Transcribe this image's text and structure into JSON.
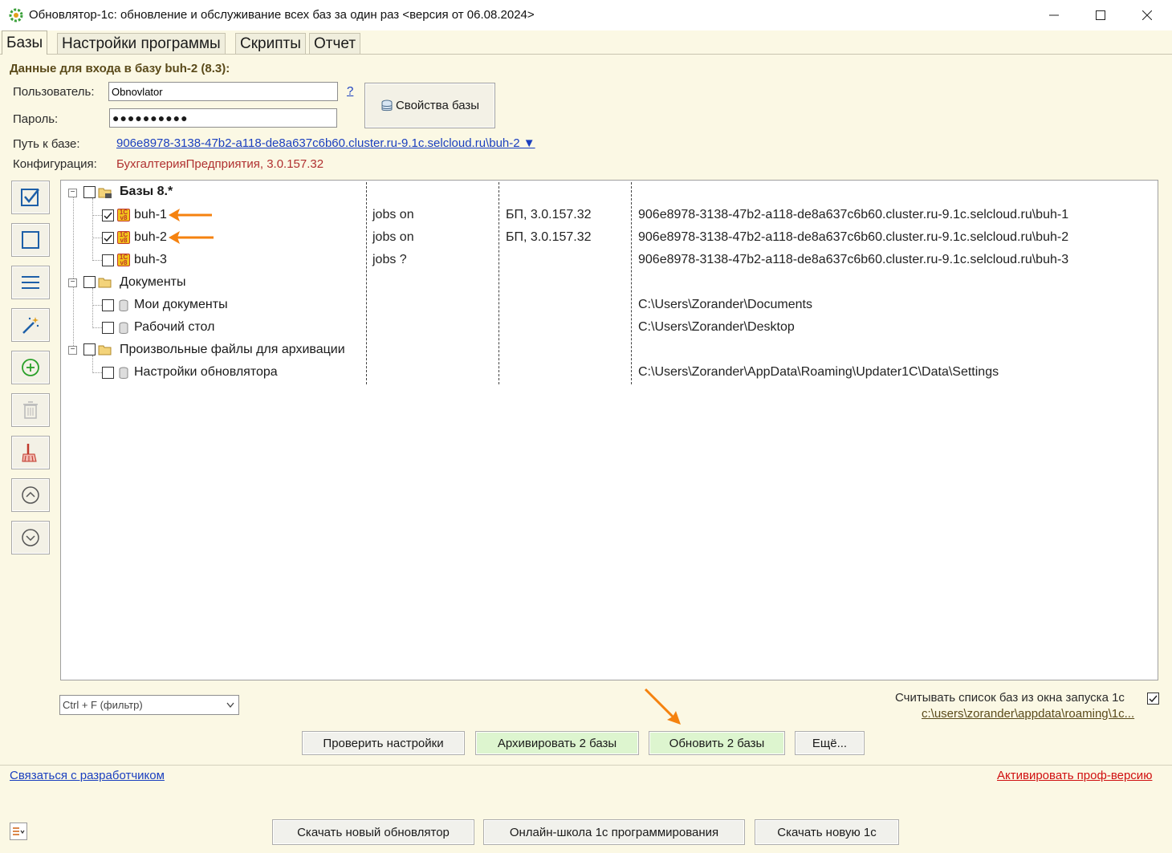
{
  "window": {
    "title": "Обновлятор-1с: обновление и обслуживание всех баз за один раз <версия от 06.08.2024>"
  },
  "tabs": [
    {
      "label": "Базы",
      "active": true
    },
    {
      "label": "Настройки программы",
      "active": false
    },
    {
      "label": "Скрипты",
      "active": false
    },
    {
      "label": "Отчет",
      "active": false
    }
  ],
  "login": {
    "heading": "Данные для входа в базу buh-2 (8.3):",
    "user_label": "Пользователь:",
    "user_value": "Obnovlator",
    "help_link": "?",
    "password_label": "Пароль:",
    "password_value": "●●●●●●●●●●",
    "db_props_button": "Свойства базы",
    "path_label": "Путь к базе:",
    "path_value": "906e8978-3138-47b2-a118-de8a637c6b60.cluster.ru-9.1c.selcloud.ru\\buh-2 ▼",
    "config_label": "Конфигурация:",
    "config_value": "БухгалтерияПредприятия, 3.0.157.32"
  },
  "tree": {
    "groups": [
      {
        "label": "Базы 8.*",
        "bold": true,
        "items": [
          {
            "name": "buh-1",
            "checked": true,
            "jobs": "jobs on",
            "config": "БП, 3.0.157.32",
            "path": "906e8978-3138-47b2-a118-de8a637c6b60.cluster.ru-9.1c.selcloud.ru\\buh-1"
          },
          {
            "name": "buh-2",
            "checked": true,
            "jobs": "jobs on",
            "config": "БП, 3.0.157.32",
            "path": "906e8978-3138-47b2-a118-de8a637c6b60.cluster.ru-9.1c.selcloud.ru\\buh-2"
          },
          {
            "name": "buh-3",
            "checked": false,
            "jobs": "jobs ?",
            "config": "",
            "path": "906e8978-3138-47b2-a118-de8a637c6b60.cluster.ru-9.1c.selcloud.ru\\buh-3"
          }
        ]
      },
      {
        "label": "Документы",
        "bold": false,
        "items": [
          {
            "name": "Мои документы",
            "checked": false,
            "jobs": "",
            "config": "",
            "path": "C:\\Users\\Zorander\\Documents"
          },
          {
            "name": "Рабочий стол",
            "checked": false,
            "jobs": "",
            "config": "",
            "path": "C:\\Users\\Zorander\\Desktop"
          }
        ]
      },
      {
        "label": "Произвольные файлы для архивации",
        "bold": false,
        "items": [
          {
            "name": "Настройки обновлятора",
            "checked": false,
            "jobs": "",
            "config": "",
            "path": "C:\\Users\\Zorander\\AppData\\Roaming\\Updater1C\\Data\\Settings"
          }
        ]
      }
    ]
  },
  "filter": {
    "placeholder": "Ctrl + F (фильтр)"
  },
  "launch_list": {
    "label": "Считывать список баз из окна запуска 1с",
    "checked": true,
    "path_link": "c:\\users\\zorander\\appdata\\roaming\\1c..."
  },
  "actions": {
    "check_settings": "Проверить настройки",
    "archive": "Архивировать 2 базы",
    "update": "Обновить 2 базы",
    "more": "Ещё..."
  },
  "footer": {
    "contact_link": "Связаться с разработчиком",
    "activate_link": "Активировать проф-версию",
    "download_updater": "Скачать новый обновлятор",
    "online_school": "Онлайн-школа 1с программирования",
    "download_1c": "Скачать новую 1с"
  },
  "colors": {
    "background": "#fbf8e4",
    "accent_green": "#ddf5cf",
    "config_text": "#b03030",
    "heading_text": "#5a4a1a",
    "link_blue": "#1a3fbf",
    "activate_red": "#d01010",
    "arrow_orange": "#f5820f"
  }
}
